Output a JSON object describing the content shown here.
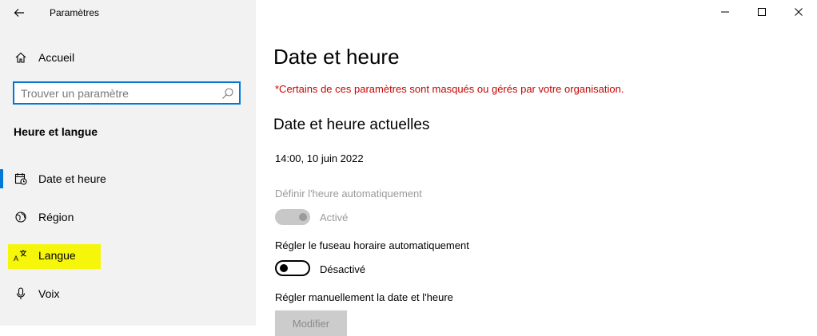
{
  "window": {
    "app_title": "Paramètres",
    "controls": {
      "minimize_icon": "minimize-icon",
      "maximize_icon": "maximize-icon",
      "close_icon": "close-icon"
    }
  },
  "sidebar": {
    "home": {
      "label": "Accueil",
      "icon": "home-icon"
    },
    "search": {
      "placeholder": "Trouver un paramètre",
      "value": "",
      "icon": "search-icon"
    },
    "section_title": "Heure et langue",
    "items": [
      {
        "label": "Date et heure",
        "icon": "calendar-clock-icon",
        "selected": true,
        "highlighted": false
      },
      {
        "label": "Région",
        "icon": "globe-icon",
        "selected": false,
        "highlighted": false
      },
      {
        "label": "Langue",
        "icon": "language-icon",
        "selected": false,
        "highlighted": true
      },
      {
        "label": "Voix",
        "icon": "microphone-icon",
        "selected": false,
        "highlighted": false
      }
    ]
  },
  "main": {
    "title": "Date et heure",
    "org_warning": "*Certains de ces paramètres sont masqués ou gérés par votre organisation.",
    "current_heading": "Date et heure actuelles",
    "current_value": "14:00, 10 juin 2022",
    "auto_time": {
      "label": "Définir l'heure automatiquement",
      "state_label": "Activé",
      "on": true,
      "disabled": true
    },
    "auto_timezone": {
      "label": "Régler le fuseau horaire automatiquement",
      "state_label": "Désactivé",
      "on": false,
      "disabled": false
    },
    "manual": {
      "label": "Régler manuellement la date et l'heure",
      "button_label": "Modifier",
      "disabled": true
    }
  },
  "colors": {
    "accent": "#0078d7",
    "warning": "#c50500",
    "highlight": "#f6f60a",
    "sidebar_bg": "#f2f2f2"
  }
}
